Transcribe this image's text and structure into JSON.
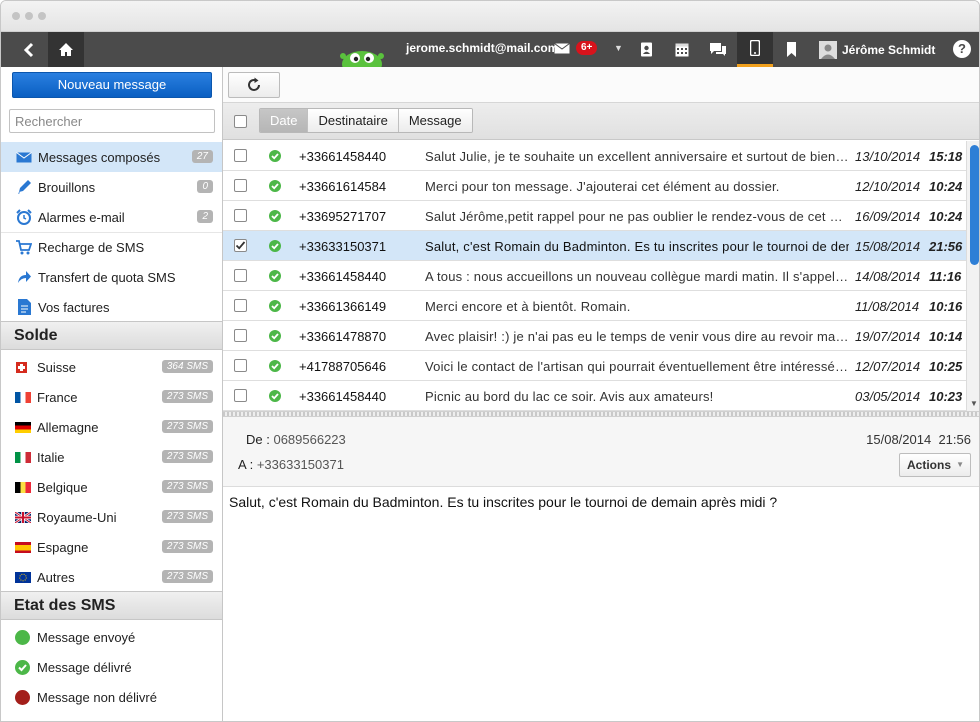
{
  "topbar": {
    "email": "jerome.schmidt@mail.com",
    "notification_count": "6+",
    "user_name": "Jérôme Schmidt",
    "help": "?",
    "active_color": "#f1a01d"
  },
  "sidebar": {
    "new_message": "Nouveau message",
    "search_placeholder": "Rechercher",
    "items": [
      {
        "label": "Messages composés",
        "count": "27",
        "icon": "envelope-icon"
      },
      {
        "label": "Brouillons",
        "count": "0",
        "icon": "pencil-icon"
      },
      {
        "label": "Alarmes e-mail",
        "count": "2",
        "icon": "alarm-clock-icon"
      },
      {
        "label": "Recharge de SMS",
        "icon": "cart-icon"
      },
      {
        "label": "Transfert de quota SMS",
        "icon": "share-arrow-icon"
      },
      {
        "label": "Vos factures",
        "icon": "document-icon"
      }
    ],
    "balance_title": "Solde",
    "balances": [
      {
        "country": "Suisse",
        "amount": "364 SMS"
      },
      {
        "country": "France",
        "amount": "273 SMS"
      },
      {
        "country": "Allemagne",
        "amount": "273 SMS"
      },
      {
        "country": "Italie",
        "amount": "273 SMS"
      },
      {
        "country": "Belgique",
        "amount": "273 SMS"
      },
      {
        "country": "Royaume-Uni",
        "amount": "273 SMS"
      },
      {
        "country": "Espagne",
        "amount": "273 SMS"
      },
      {
        "country": "Autres",
        "amount": "273 SMS"
      }
    ],
    "status_title": "Etat des SMS",
    "statuses": [
      {
        "label": "Message envoyé",
        "color": "#4cb748"
      },
      {
        "label": "Message délivré",
        "color": "#4cb748"
      },
      {
        "label": "Message non délivré",
        "color": "#a31f1a"
      }
    ]
  },
  "sort": {
    "date": "Date",
    "recipient": "Destinataire",
    "message": "Message"
  },
  "messages": [
    {
      "phone": "+33661458440",
      "text": "Salut Julie, je te souhaite un excellent anniversaire et surtout de bien passer ta journée",
      "date": "13/10/2014",
      "time": "15:18"
    },
    {
      "phone": "+33661614584",
      "text": "Merci pour ton message. J'ajouterai cet élément au dossier.",
      "date": "12/10/2014",
      "time": "10:24"
    },
    {
      "phone": "+33695271707",
      "text": "Salut Jérôme,petit rappel pour ne pas oublier le rendez-vous de cet après-midi",
      "date": "16/09/2014",
      "time": "10:24"
    },
    {
      "phone": "+33633150371",
      "text": "Salut, c'est Romain du Badminton. Es tu inscrites pour le tournoi de demain après midi ?",
      "date": "15/08/2014",
      "time": "21:56",
      "selected": true
    },
    {
      "phone": "+33661458440",
      "text": "A tous : nous accueillons un nouveau collègue mardi matin. Il s'appelle Marc",
      "date": "14/08/2014",
      "time": "11:16"
    },
    {
      "phone": "+33661366149",
      "text": "Merci encore et à bientôt. Romain.",
      "date": "11/08/2014",
      "time": "10:16"
    },
    {
      "phone": "+33661478870",
      "text": "Avec plaisir! :) je n'ai pas eu le temps de venir vous dire au revoir mardi",
      "date": "19/07/2014",
      "time": "10:14"
    },
    {
      "phone": "+41788705646",
      "text": "Voici le contact de l'artisan qui pourrait éventuellement être intéressé par le projet",
      "date": "12/07/2014",
      "time": "10:25"
    },
    {
      "phone": "+33661458440",
      "text": "Picnic au bord du lac ce soir. Avis aux amateurs!",
      "date": "03/05/2014",
      "time": "10:23"
    }
  ],
  "detail": {
    "from_label": "De :",
    "from": "0689566223",
    "to_label": "A :",
    "to": "+33633150371",
    "date": "15/08/2014",
    "time": "21:56",
    "actions": "Actions",
    "body": "Salut, c'est Romain du Badminton. Es tu inscrites pour le tournoi de demain après midi ?"
  }
}
